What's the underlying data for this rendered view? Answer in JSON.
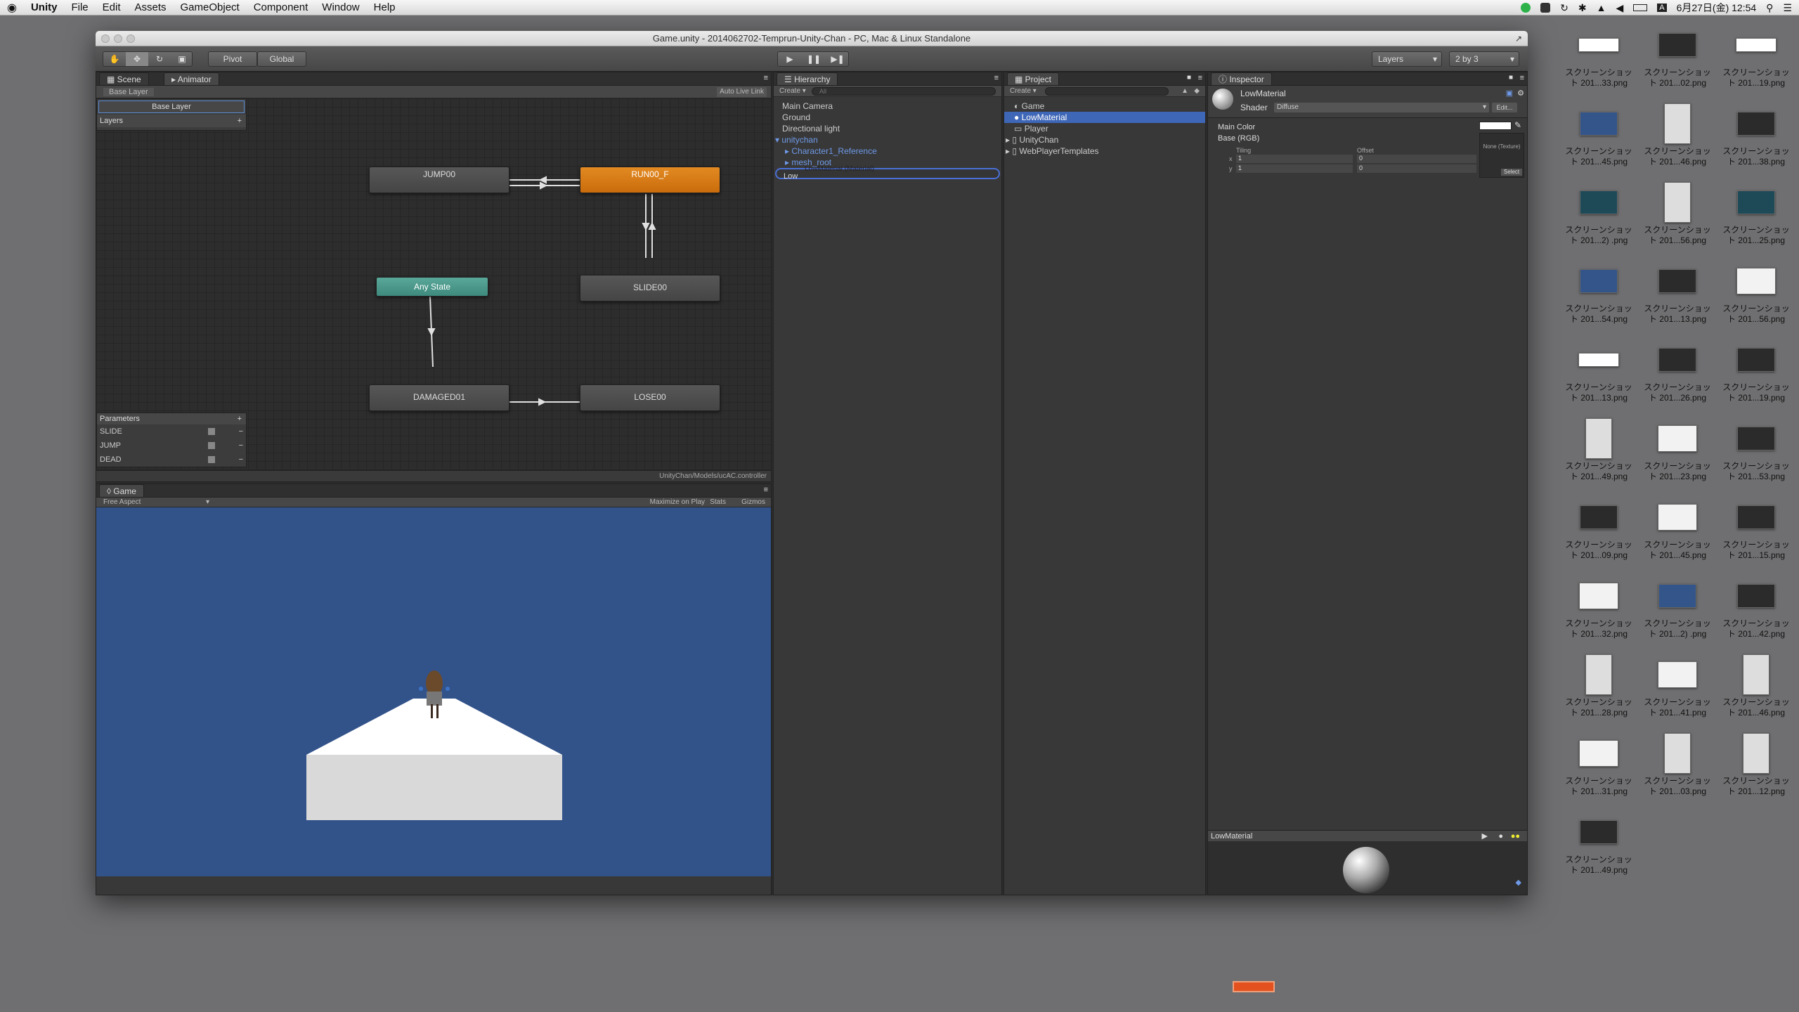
{
  "menubar": {
    "apple": "",
    "app": "Unity",
    "items": [
      "File",
      "Edit",
      "Assets",
      "GameObject",
      "Component",
      "Window",
      "Help"
    ],
    "clock": "6月27日(金)  12:54",
    "input_indicator": "A"
  },
  "window": {
    "title": "Game.unity - 2014062702-Temprun-Unity-Chan - PC, Mac & Linux Standalone"
  },
  "toolbar": {
    "pivot": "Pivot",
    "global": "Global",
    "layers": "Layers",
    "layout": "2 by 3"
  },
  "animator": {
    "tab_scene": "Scene",
    "tab_animator": "Animator",
    "breadcrumb": "Base Layer",
    "auto_live_link": "Auto Live Link",
    "layer_name": "Base Layer",
    "layers_header": "Layers",
    "layers_add": "+",
    "parameters_header": "Parameters",
    "parameters_add": "+",
    "parameters": [
      {
        "name": "SLIDE",
        "remove": "−"
      },
      {
        "name": "JUMP",
        "remove": "−"
      },
      {
        "name": "DEAD",
        "remove": "−"
      }
    ],
    "states": {
      "jump": "JUMP00",
      "run": "RUN00_F",
      "any": "Any State",
      "slide": "SLIDE00",
      "damaged": "DAMAGED01",
      "lose": "LOSE00"
    },
    "controller_path": "UnityChan/Models/ucAC.controller"
  },
  "game": {
    "tab": "Game",
    "aspect": "Free Aspect",
    "maximize": "Maximize on Play",
    "stats": "Stats",
    "gizmos": "Gizmos"
  },
  "hierarchy": {
    "tab": "Hierarchy",
    "create": "Create",
    "search_placeholder": "All",
    "items": [
      "Main Camera",
      "Ground",
      "Directional light"
    ],
    "unitychan": "unitychan",
    "children": [
      "Character1_Reference",
      "mesh_root"
    ],
    "rename_value": "Low",
    "drag_label": "LowMaterial (Material)"
  },
  "project": {
    "tab": "Project",
    "create": "Create",
    "items": [
      "Game",
      "LowMaterial",
      "Player",
      "UnityChan",
      "WebPlayerTemplates"
    ]
  },
  "inspector": {
    "tab": "Inspector",
    "name": "LowMaterial",
    "shader_label": "Shader",
    "shader_value": "Diffuse",
    "edit": "Edit...",
    "main_color": "Main Color",
    "base_rgb": "Base (RGB)",
    "tiling": "Tiling",
    "offset": "Offset",
    "x_label": "x",
    "y_label": "y",
    "tiling_x": "1",
    "tiling_y": "1",
    "offset_x": "0",
    "offset_y": "0",
    "texture_none": "None (Texture)",
    "select": "Select",
    "preview_title": "LowMaterial"
  },
  "desktop": {
    "icons": [
      {
        "l1": "スクリーンショッ",
        "l2": "ト 201...33.png",
        "kind": "wide"
      },
      {
        "l1": "スクリーンショッ",
        "l2": "ト 201...02.png",
        "kind": "dark"
      },
      {
        "l1": "スクリーンショッ",
        "l2": "ト 201...19.png",
        "kind": "wide"
      },
      {
        "l1": "スクリーンショッ",
        "l2": "ト 201...45.png",
        "kind": "blue"
      },
      {
        "l1": "スクリーンショッ",
        "l2": "ト 201...46.png",
        "kind": "tall"
      },
      {
        "l1": "スクリーンショッ",
        "l2": "ト 201...38.png",
        "kind": "dark"
      },
      {
        "l1": "スクリーンショッ",
        "l2": "ト 201...2) .png",
        "kind": "teal"
      },
      {
        "l1": "スクリーンショッ",
        "l2": "ト 201...56.png",
        "kind": "tall"
      },
      {
        "l1": "スクリーンショッ",
        "l2": "ト 201...25.png",
        "kind": "teal"
      },
      {
        "l1": "スクリーンショッ",
        "l2": "ト 201...54.png",
        "kind": "blue"
      },
      {
        "l1": "スクリーンショッ",
        "l2": "ト 201...13.png",
        "kind": "dark"
      },
      {
        "l1": "スクリーンショッ",
        "l2": "ト 201...56.png",
        "kind": "light"
      },
      {
        "l1": "スクリーンショッ",
        "l2": "ト 201...13.png",
        "kind": "wide"
      },
      {
        "l1": "スクリーンショッ",
        "l2": "ト 201...26.png",
        "kind": "dark"
      },
      {
        "l1": "スクリーンショッ",
        "l2": "ト 201...19.png",
        "kind": "dark"
      },
      {
        "l1": "スクリーンショッ",
        "l2": "ト 201...49.png",
        "kind": "tall"
      },
      {
        "l1": "スクリーンショッ",
        "l2": "ト 201...23.png",
        "kind": "light"
      },
      {
        "l1": "スクリーンショッ",
        "l2": "ト 201...53.png",
        "kind": "dark"
      },
      {
        "l1": "スクリーンショッ",
        "l2": "ト 201...09.png",
        "kind": "dark"
      },
      {
        "l1": "スクリーンショッ",
        "l2": "ト 201...45.png",
        "kind": "light"
      },
      {
        "l1": "スクリーンショッ",
        "l2": "ト 201...15.png",
        "kind": "dark"
      },
      {
        "l1": "スクリーンショッ",
        "l2": "ト 201...32.png",
        "kind": "light"
      },
      {
        "l1": "スクリーンショッ",
        "l2": "ト 201...2) .png",
        "kind": "blue"
      },
      {
        "l1": "スクリーンショッ",
        "l2": "ト 201...42.png",
        "kind": "dark"
      },
      {
        "l1": "スクリーンショッ",
        "l2": "ト 201...28.png",
        "kind": "tall"
      },
      {
        "l1": "スクリーンショッ",
        "l2": "ト 201...41.png",
        "kind": "light"
      },
      {
        "l1": "スクリーンショッ",
        "l2": "ト 201...46.png",
        "kind": "tall"
      },
      {
        "l1": "スクリーンショッ",
        "l2": "ト 201...31.png",
        "kind": "light"
      },
      {
        "l1": "スクリーンショッ",
        "l2": "ト 201...03.png",
        "kind": "tall"
      },
      {
        "l1": "スクリーンショッ",
        "l2": "ト 201...12.png",
        "kind": "tall"
      },
      {
        "l1": "スクリーンショッ",
        "l2": "ト 201...49.png",
        "kind": "dark"
      }
    ]
  }
}
